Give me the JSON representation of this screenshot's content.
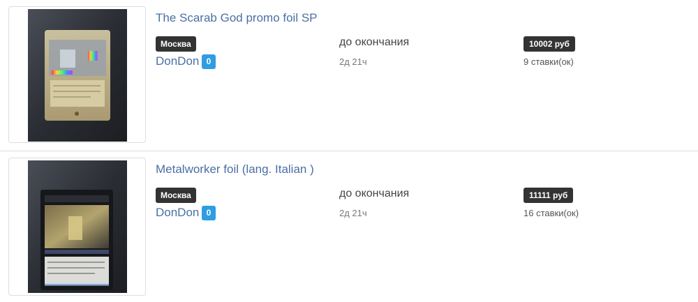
{
  "lots": [
    {
      "title": "The Scarab God promo foil SP",
      "city": "Москва",
      "seller": "DonDon",
      "rating": "0",
      "until_label": "до окончания",
      "time_left": "2д 21ч",
      "price": "10002 руб",
      "bids": "9 ставки(ок)"
    },
    {
      "title": "Metalworker foil (lang. Italian )",
      "city": "Москва",
      "seller": "DonDon",
      "rating": "0",
      "until_label": "до окончания",
      "time_left": "2д 21ч",
      "price": "11111 руб",
      "bids": "16 ставки(ок)"
    }
  ],
  "colors": {
    "link": "#4a6fa5",
    "badge_dark": "#333333",
    "badge_blue": "#2f9de3"
  }
}
